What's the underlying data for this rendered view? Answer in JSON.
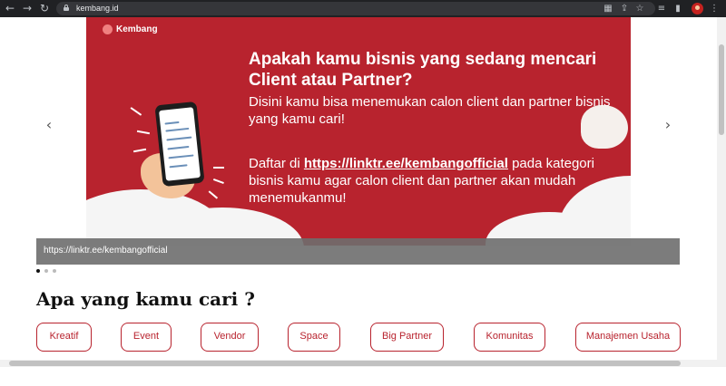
{
  "browser": {
    "url": "kembang.id",
    "nav": {
      "back": "←",
      "forward": "→",
      "reload": "↻"
    },
    "toolbar_icons": [
      "translate-icon",
      "share-icon",
      "star-icon",
      "media-icon",
      "sidepanel-icon",
      "profile-avatar",
      "menu-icon"
    ],
    "menu_glyph": "⋮",
    "star_glyph": "☆"
  },
  "carousel": {
    "prev_glyph": "‹",
    "next_glyph": "›",
    "slide": {
      "logo_text": "Kembang",
      "headline": "Apakah kamu bisnis yang sedang mencari Client atau Partner?",
      "paragraph1": "Disini kamu bisa menemukan calon client dan partner bisnis yang kamu cari!",
      "paragraph2_prefix": "Daftar di ",
      "paragraph2_link": "https://linktr.ee/kembangofficial",
      "paragraph2_suffix": " pada kategori bisnis kamu agar calon client dan partner akan mudah menemukanmu!"
    },
    "caption": "https://linktr.ee/kembangofficial",
    "dots_total": 3,
    "active_dot": 0
  },
  "section": {
    "title": "Apa yang kamu cari ?"
  },
  "categories": [
    "Kreatif",
    "Event",
    "Vendor",
    "Space",
    "Big Partner",
    "Komunitas",
    "Manajemen Usaha"
  ],
  "colors": {
    "brand": "#b8232e",
    "chrome": "#202124"
  }
}
